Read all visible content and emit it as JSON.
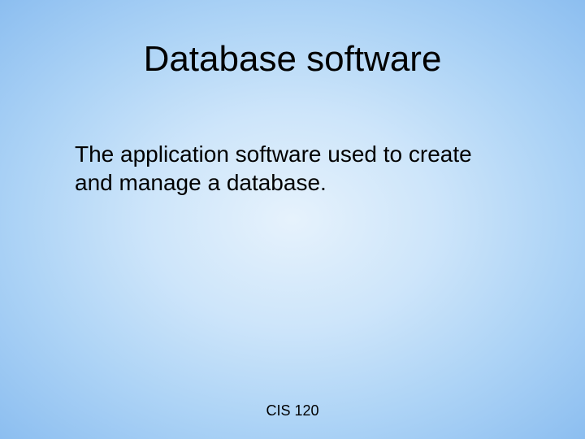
{
  "slide": {
    "title": "Database software",
    "body": "The application software used to create and manage a database.",
    "footer": "CIS 120"
  }
}
